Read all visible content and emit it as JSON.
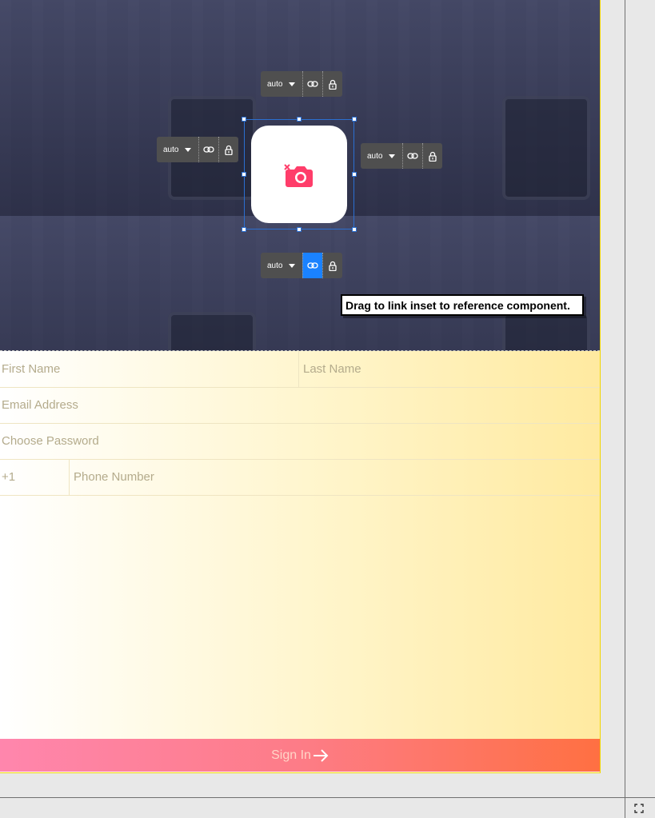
{
  "hero": {
    "background_color": "#3b3f5c",
    "avatar_icon": "camera-icon",
    "remove_icon": "close-icon"
  },
  "inset_controls": {
    "top": {
      "value": "auto",
      "linked": false
    },
    "left": {
      "value": "auto",
      "linked": false
    },
    "right": {
      "value": "auto",
      "linked": false
    },
    "bottom": {
      "value": "auto",
      "linked": true
    }
  },
  "tooltip": "Drag to link inset to reference component.",
  "form": {
    "first_name_placeholder": "First Name",
    "last_name_placeholder": "Last Name",
    "email_placeholder": "Email Address",
    "password_placeholder": "Choose Password",
    "country_code": "+1",
    "phone_placeholder": "Phone Number",
    "sign_in_label": "Sign In"
  },
  "colors": {
    "accent": "#ff3d6a",
    "selection": "#2b6fd1",
    "link_active": "#1a82ff",
    "frame_border": "#f2d600"
  }
}
